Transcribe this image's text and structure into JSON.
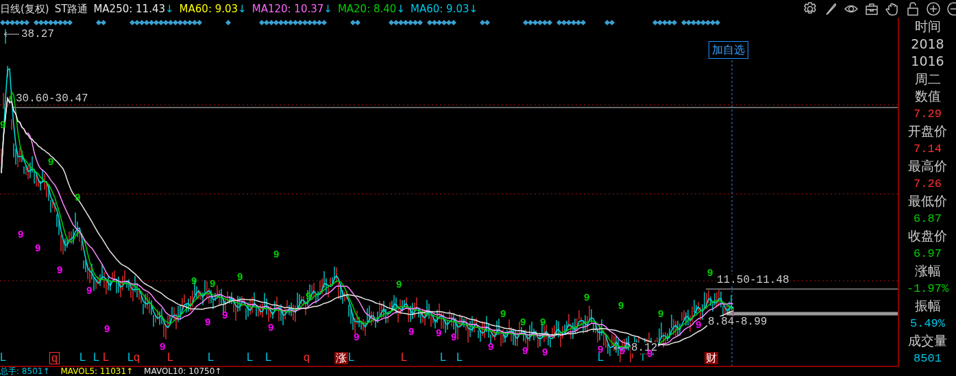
{
  "legend": {
    "period": "日线(复权)",
    "stock": "ST路通",
    "items": [
      {
        "text": "MA250: 11.43",
        "arrow": "↓",
        "color": "#e8e8e8"
      },
      {
        "text": "MA60: 9.03",
        "arrow": "↓",
        "color": "#ffff00"
      },
      {
        "text": "MA120: 10.37",
        "arrow": "↓",
        "color": "#ff66ff"
      },
      {
        "text": "MA20: 8.40",
        "arrow": "↓",
        "color": "#00d000"
      },
      {
        "text": "MA60: 9.03",
        "arrow": "↓",
        "color": "#00c8e8"
      }
    ]
  },
  "chart": {
    "add_button": "加自选",
    "price_labels": [
      {
        "text": "38.27",
        "kind": "peak"
      },
      {
        "text": "30.60-30.47",
        "kind": "range"
      },
      {
        "text": "11.50-11.48",
        "kind": "range"
      },
      {
        "text": "8.84-8.99",
        "kind": "range"
      },
      {
        "text": "8.12",
        "kind": "low"
      }
    ],
    "count_marks": [
      {
        "text": "9",
        "kind": "top"
      },
      {
        "text": "9",
        "kind": "bottom"
      },
      {
        "text": "9",
        "kind": "bottom"
      },
      {
        "text": "9",
        "kind": "top"
      },
      {
        "text": "9",
        "kind": "bottom"
      },
      {
        "text": "9",
        "kind": "top"
      },
      {
        "text": "9",
        "kind": "bottom"
      },
      {
        "text": "9",
        "kind": "bottom"
      },
      {
        "text": "9",
        "kind": "bottom"
      },
      {
        "text": "9",
        "kind": "top"
      },
      {
        "text": "9",
        "kind": "bottom"
      },
      {
        "text": "9",
        "kind": "top"
      },
      {
        "text": "9",
        "kind": "bottom"
      },
      {
        "text": "9",
        "kind": "top"
      },
      {
        "text": "9",
        "kind": "bottom"
      },
      {
        "text": "9",
        "kind": "top"
      },
      {
        "text": "9",
        "kind": "top"
      },
      {
        "text": "9",
        "kind": "bottom"
      },
      {
        "text": "9",
        "kind": "top"
      },
      {
        "text": "9",
        "kind": "bottom"
      },
      {
        "text": "9",
        "kind": "bottom"
      },
      {
        "text": "9",
        "kind": "bottom"
      },
      {
        "text": "9",
        "kind": "bottom"
      },
      {
        "text": "9",
        "kind": "top"
      },
      {
        "text": "9",
        "kind": "top"
      },
      {
        "text": "9",
        "kind": "bottom"
      },
      {
        "text": "9",
        "kind": "top"
      },
      {
        "text": "9",
        "kind": "bottom"
      },
      {
        "text": "9",
        "kind": "top"
      },
      {
        "text": "9",
        "kind": "bottom"
      },
      {
        "text": "9",
        "kind": "top"
      },
      {
        "text": "9",
        "kind": "bottom"
      },
      {
        "text": "9",
        "kind": "bottom"
      },
      {
        "text": "9",
        "kind": "top"
      },
      {
        "text": "9",
        "kind": "bottom"
      },
      {
        "text": "9",
        "kind": "top"
      }
    ],
    "signals": [
      {
        "text": "L",
        "kind": "letter",
        "color": "#00c8e8"
      },
      {
        "text": "q",
        "kind": "boxed",
        "color": "#ff3030"
      },
      {
        "text": "L",
        "kind": "letter",
        "color": "#00c8e8"
      },
      {
        "text": "L",
        "kind": "letter",
        "color": "#00c8e8"
      },
      {
        "text": "L",
        "kind": "letter",
        "color": "#ff3030"
      },
      {
        "text": "L",
        "kind": "letter",
        "color": "#00c8e8"
      },
      {
        "text": "q",
        "kind": "letter",
        "color": "#ff3030"
      },
      {
        "text": "L",
        "kind": "letter",
        "color": "#ff3030"
      },
      {
        "text": "L",
        "kind": "letter",
        "color": "#00c8e8"
      },
      {
        "text": "L",
        "kind": "letter",
        "color": "#00c8e8"
      },
      {
        "text": "L",
        "kind": "letter",
        "color": "#00c8e8"
      },
      {
        "text": "q",
        "kind": "letter",
        "color": "#ff3030"
      },
      {
        "text": "涨",
        "kind": "tag",
        "color": "#8b0000"
      },
      {
        "text": "L",
        "kind": "letter",
        "color": "#00c8e8"
      },
      {
        "text": "L",
        "kind": "letter",
        "color": "#ff3030"
      },
      {
        "text": "L",
        "kind": "letter",
        "color": "#00c8e8"
      },
      {
        "text": "L",
        "kind": "letter",
        "color": "#00c8e8"
      },
      {
        "text": "L",
        "kind": "letter",
        "color": "#00c8e8"
      },
      {
        "text": "财",
        "kind": "tag",
        "color": "#8b0000"
      }
    ]
  },
  "info_panel": {
    "time_label": "时间",
    "date_lines": [
      "2018",
      "1016",
      "周二"
    ],
    "fields": [
      {
        "label": "数值",
        "value": "7.29",
        "color": "#ff3030"
      },
      {
        "label": "开盘价",
        "value": "7.14",
        "color": "#ff3030"
      },
      {
        "label": "最高价",
        "value": "7.26",
        "color": "#ff3030"
      },
      {
        "label": "最低价",
        "value": "6.87",
        "color": "#00d000"
      },
      {
        "label": "收盘价",
        "value": "6.97",
        "color": "#00d000"
      },
      {
        "label": "涨幅",
        "value": "-1.97%",
        "color": "#00d000"
      },
      {
        "label": "振幅",
        "value": "5.49%",
        "color": "#00c8e8"
      },
      {
        "label": "成交量",
        "value": "8501",
        "color": "#00c8e8"
      }
    ]
  },
  "volume_legend": [
    {
      "text": "总手: 8501↑",
      "color": "#00c8e8"
    },
    {
      "text": "MAVOL5: 11031↑",
      "color": "#ffff00"
    },
    {
      "text": "MAVOL10: 10750↑",
      "color": "#e8e8e8"
    }
  ]
}
